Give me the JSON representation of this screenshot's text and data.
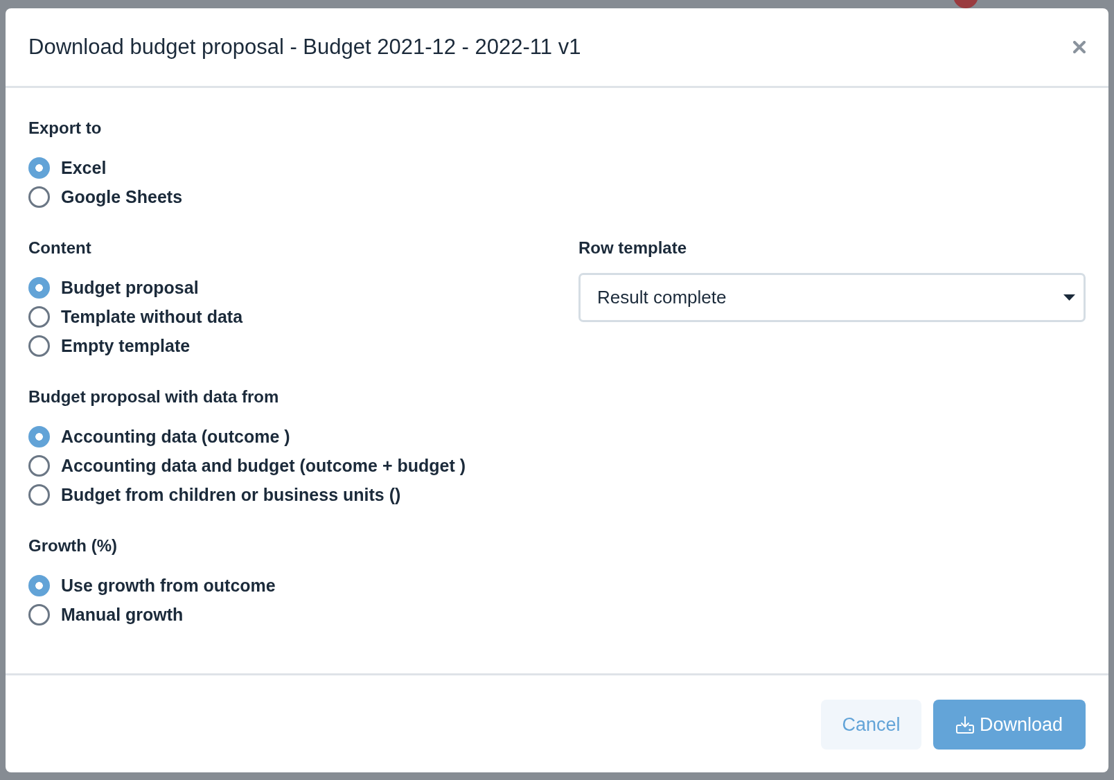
{
  "dialog": {
    "title": "Download budget proposal - Budget 2021-12 - 2022-11 v1"
  },
  "export_to": {
    "label": "Export to",
    "options": [
      {
        "label": "Excel",
        "selected": true
      },
      {
        "label": "Google Sheets",
        "selected": false
      }
    ]
  },
  "left_sections": [
    {
      "label": "Content",
      "options": [
        {
          "label": "Budget proposal",
          "selected": true
        },
        {
          "label": "Template without data",
          "selected": false
        },
        {
          "label": "Empty template",
          "selected": false
        }
      ]
    },
    {
      "label": "Budget proposal with data from",
      "options": [
        {
          "label": "Accounting data (outcome )",
          "selected": true
        },
        {
          "label": "Accounting data and budget (outcome + budget )",
          "selected": false
        },
        {
          "label": "Budget from children or business units ()",
          "selected": false
        }
      ]
    },
    {
      "label": "Growth (%)",
      "options": [
        {
          "label": "Use growth from outcome",
          "selected": true
        },
        {
          "label": "Manual growth",
          "selected": false
        }
      ]
    }
  ],
  "row_template": {
    "label": "Row template",
    "value": "Result complete"
  },
  "buttons": [
    {
      "label": "Cancel",
      "kind": "secondary"
    },
    {
      "label": "Download",
      "kind": "primary"
    }
  ]
}
